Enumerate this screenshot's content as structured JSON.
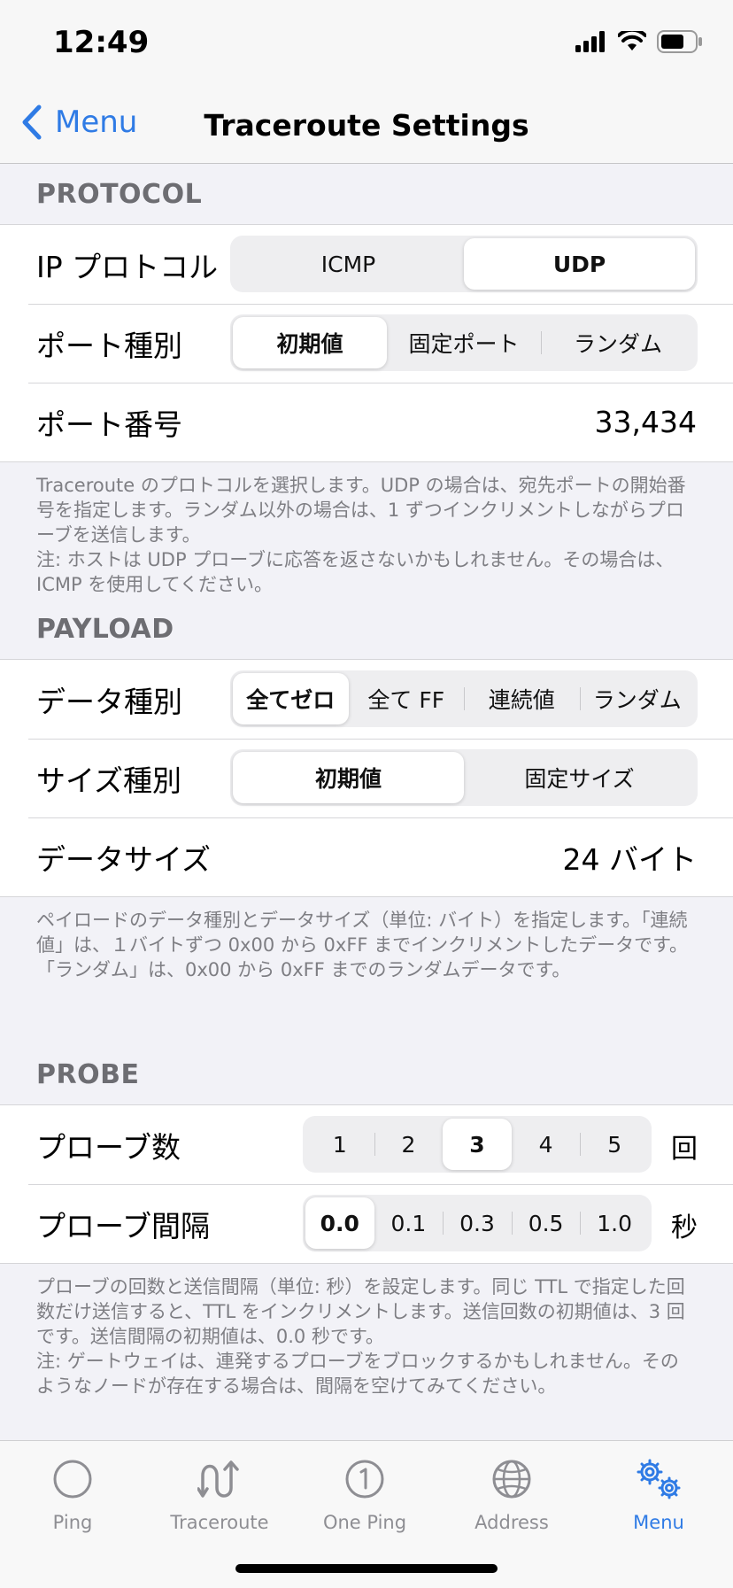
{
  "status": {
    "time": "12:49"
  },
  "nav": {
    "back_label": "Menu",
    "title": "Traceroute Settings"
  },
  "protocol": {
    "header": "PROTOCOL",
    "ip_label": "IP プロトコル",
    "ip_options": [
      "ICMP",
      "UDP"
    ],
    "ip_selected": "UDP",
    "port_kind_label": "ポート種別",
    "port_kind_options": [
      "初期値",
      "固定ポート",
      "ランダム"
    ],
    "port_kind_selected": "初期値",
    "port_number_label": "ポート番号",
    "port_number_value": "33,434",
    "footer": "Traceroute のプロトコルを選択します。UDP の場合は、宛先ポートの開始番号を指定します。ランダム以外の場合は、1 ずつインクリメントしながらプローブを送信します。\n注: ホストは UDP プローブに応答を返さないかもしれません。その場合は、ICMP を使用してください。"
  },
  "payload": {
    "header": "PAYLOAD",
    "data_kind_label": "データ種別",
    "data_kind_options": [
      "全てゼロ",
      "全て FF",
      "連続値",
      "ランダム"
    ],
    "data_kind_selected": "全てゼロ",
    "size_kind_label": "サイズ種別",
    "size_kind_options": [
      "初期値",
      "固定サイズ"
    ],
    "size_kind_selected": "初期値",
    "data_size_label": "データサイズ",
    "data_size_value": "24 バイト",
    "footer": "ペイロードのデータ種別とデータサイズ（単位: バイト）を指定します。「連続値」は、１バイトずつ 0x00 から 0xFF までインクリメントしたデータです。「ランダム」は、0x00 から 0xFF までのランダムデータです。"
  },
  "probe": {
    "header": "PROBE",
    "count_label": "プローブ数",
    "count_options": [
      "1",
      "2",
      "3",
      "4",
      "5"
    ],
    "count_selected": "3",
    "count_unit": "回",
    "interval_label": "プローブ間隔",
    "interval_options": [
      "0.0",
      "0.1",
      "0.3",
      "0.5",
      "1.0"
    ],
    "interval_selected": "0.0",
    "interval_unit": "秒",
    "footer": "プローブの回数と送信間隔（単位: 秒）を設定します。同じ TTL で指定した回数だけ送信すると、TTL をインクリメントします。送信回数の初期値は、3 回です。送信間隔の初期値は、0.0 秒です。\n注: ゲートウェイは、連発するプローブをブロックするかもしれません。そのようなノードが存在する場合は、間隔を空けてみてください。"
  },
  "tabs": [
    {
      "label": "Ping",
      "icon": "circle-icon"
    },
    {
      "label": "Traceroute",
      "icon": "traceroute-icon"
    },
    {
      "label": "One Ping",
      "icon": "one-ping-icon"
    },
    {
      "label": "Address",
      "icon": "globe-icon"
    },
    {
      "label": "Menu",
      "icon": "gears-icon"
    }
  ],
  "active_tab": "Menu",
  "colors": {
    "accent": "#2f7be5",
    "background": "#f2f2f7"
  }
}
